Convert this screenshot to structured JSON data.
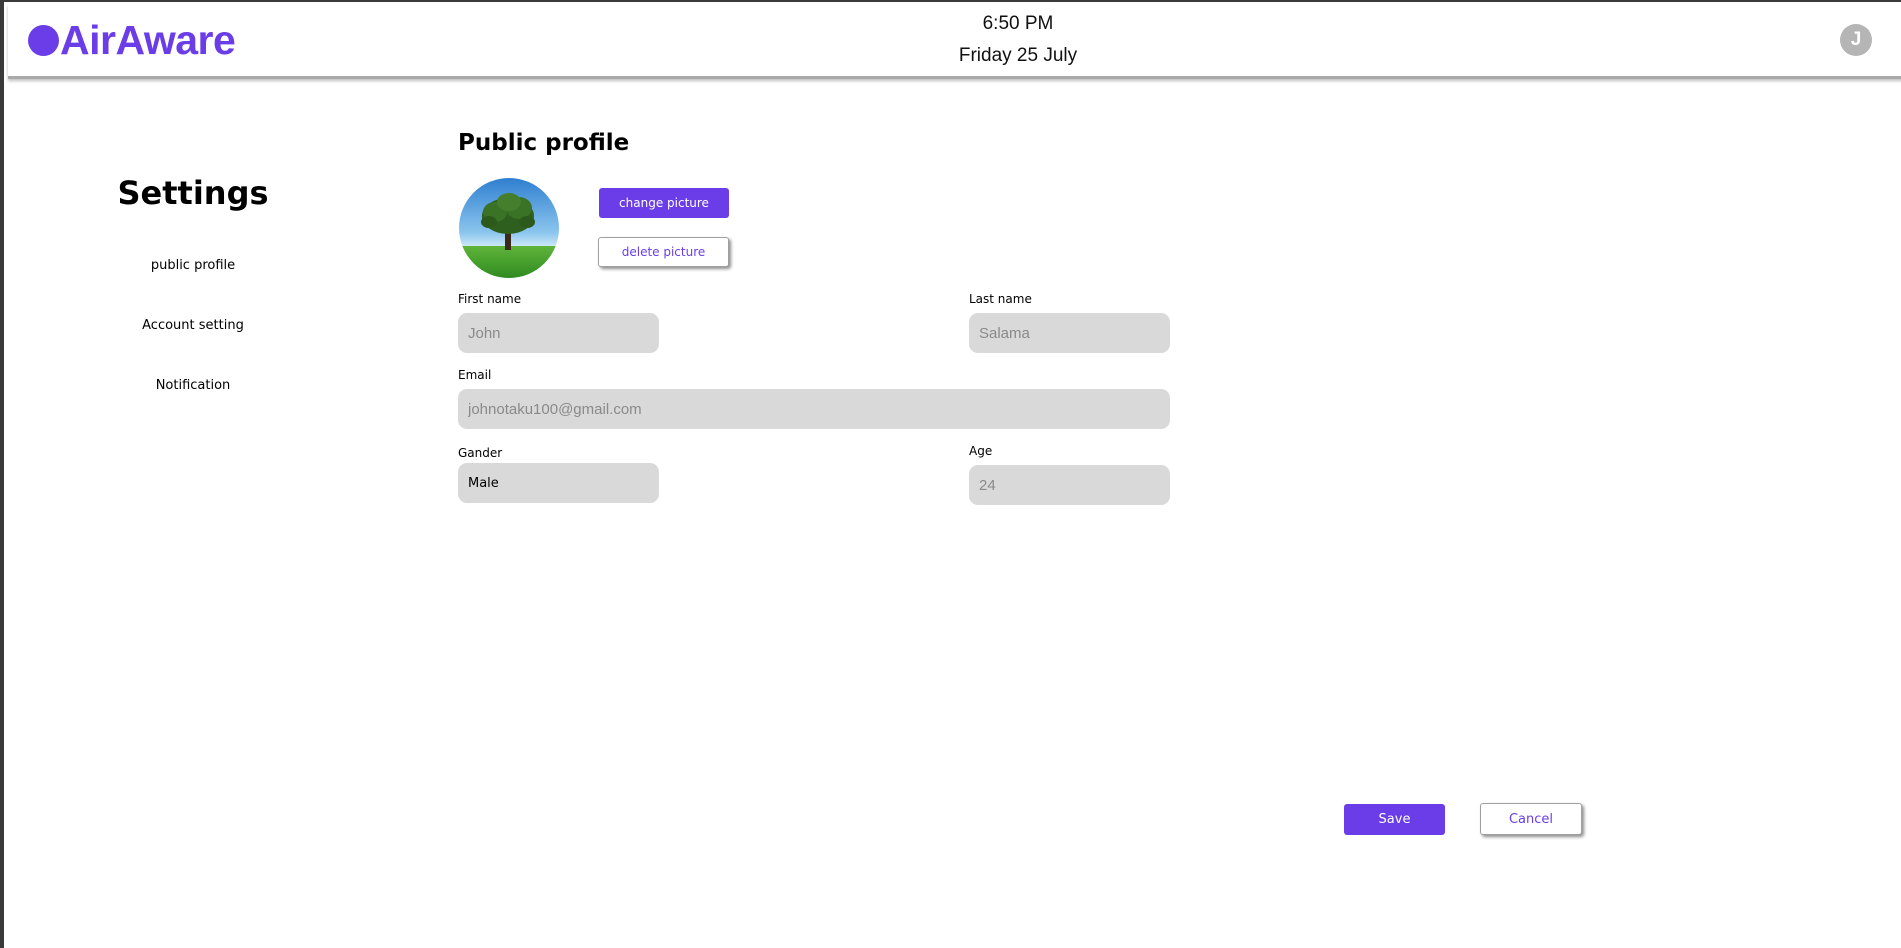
{
  "header": {
    "brand": "AirAware",
    "time": "6:50 PM",
    "date": "Friday 25 July",
    "avatar_initial": "J"
  },
  "sidebar": {
    "title": "Settings",
    "items": [
      {
        "label": "public profile"
      },
      {
        "label": "Account setting"
      },
      {
        "label": "Notification"
      }
    ]
  },
  "profile": {
    "section_title": "Public profile",
    "change_picture_label": "change picture",
    "delete_picture_label": "delete picture",
    "first_name": {
      "label": "First name",
      "placeholder": "John"
    },
    "last_name": {
      "label": "Last name",
      "placeholder": "Salama"
    },
    "email": {
      "label": "Email",
      "placeholder": "johnotaku100@gmail.com"
    },
    "gender": {
      "label": "Gander",
      "selected": "Male"
    },
    "age": {
      "label": "Age",
      "placeholder": "24"
    }
  },
  "actions": {
    "save_label": "Save",
    "cancel_label": "Cancel"
  },
  "colors": {
    "accent": "#6a3de8",
    "field_bg": "#d9d9d9",
    "avatar_bg": "#b5b5b5"
  },
  "icons": {
    "logo": "circle-dot-icon",
    "profile_picture": "tree-landscape-image"
  }
}
